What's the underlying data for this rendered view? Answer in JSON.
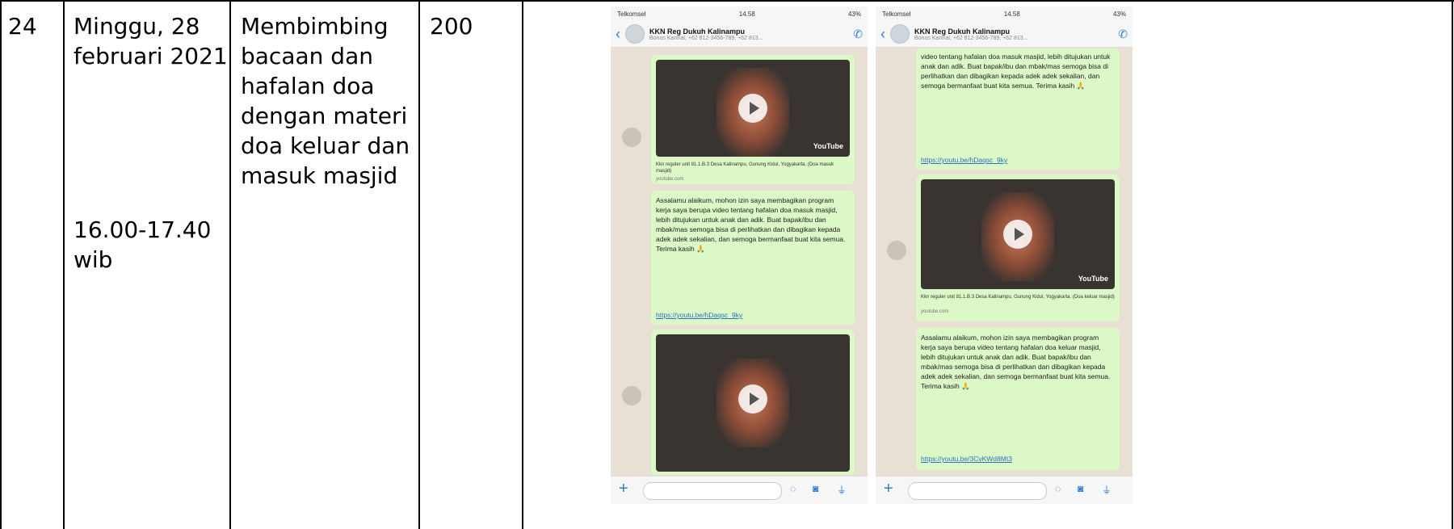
{
  "row": {
    "number": "24",
    "date_line1": "Minggu, 28",
    "date_line2": "februari 2021",
    "time_line1": "16.00-17.40",
    "time_line2": "wib",
    "activity_lines": [
      "Membimbing",
      "bacaan dan",
      "hafalan doa",
      "dengan materi",
      "doa keluar dan",
      "masuk masjid"
    ],
    "participants": "200"
  },
  "phones": [
    {
      "status_left": "Telkomsel",
      "status_time": "14.58",
      "status_right": "43%",
      "group_title": "KKN Reg Dukuh Kalinampu",
      "group_sub": "Bonus Karmal, +62 812-3456-789, +62 813...",
      "video_caption": "Kkn reguler unit 81.1.B.3 Desa Kalinampu, Gunung Kidul, Yogyakarta. (Doa masuk masjid)",
      "video_caption_sub": "youtube.com",
      "message": "Assalamu alaikum, mohon izin saya membagikan program kerja saya berupa video tentang hafalan doa masuk masjid, lebih ditujukan untuk anak dan adik. Buat bapak/ibu dan mbak/mas semoga bisa di perlihatkan dan dibagikan kepada adek adek sekalian, dan semoga bermanfaat buat kita semua. Terima kasih 🙏",
      "link": "https://youtu.be/hDaqsc_9ky",
      "youtube_label": "YouTube"
    },
    {
      "status_left": "Telkomsel",
      "status_time": "14.58",
      "status_right": "43%",
      "group_title": "KKN Reg Dukuh Kalinampu",
      "group_sub": "Bonus Karmal, +62 812-3456-789, +62 813...",
      "top_message": "video tentang hafalan doa masuk masjid, lebih ditujukan untuk anak dan adik. Buat bapak/ibu dan mbak/mas semoga bisa di perlihatkan dan dibagikan kepada adek adek sekalian, dan semoga bermanfaat buat kita semua. Terima kasih 🙏",
      "top_link": "https://youtu.be/hDaqsc_9ky",
      "video_caption": "Kkn reguler unit 81.1.B.3 Desa Kalinampu, Gunung Kidul, Yogyakarta. (Doa keluar masjid)",
      "video_caption_sub": "youtube.com",
      "message": "Assalamu alaikum, mohon izin saya membagikan program kerja saya berupa video tentang hafalan doa keluar masjid, lebih ditujukan untuk anak dan adik. Buat bapak/ibu dan mbak/mas semoga bisa di perlihatkan dan dibagikan kepada adek adek sekalian, dan semoga bermanfaat buat kita semua. Terima kasih 🙏",
      "link": "https://youtu.be/3CvKWd8Mt3",
      "youtube_label": "YouTube"
    }
  ]
}
